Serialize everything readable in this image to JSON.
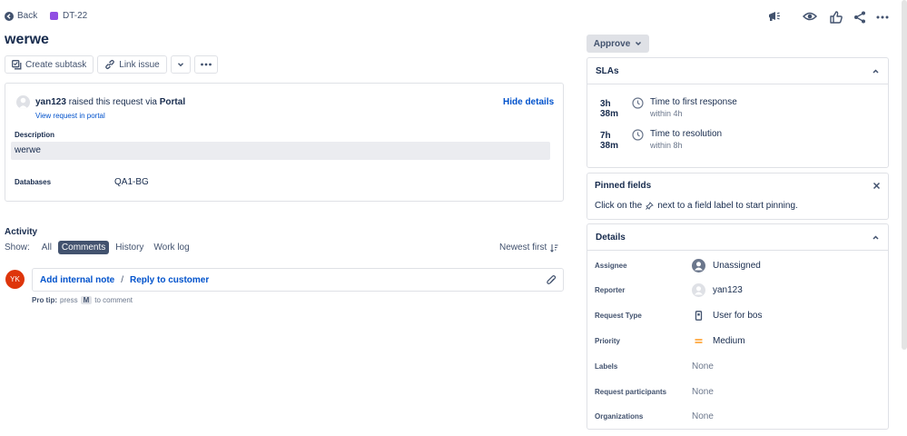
{
  "nav": {
    "back_label": "Back",
    "issue_key": "DT-22"
  },
  "issue": {
    "title": "werwe"
  },
  "toolbar": {
    "create_subtask": "Create subtask",
    "link_issue": "Link issue"
  },
  "request": {
    "user": "yan123",
    "raised_text": "raised this request via",
    "channel": "Portal",
    "view_link": "View request in portal",
    "hide_details": "Hide details",
    "description_label": "Description",
    "description_value": "werwe",
    "databases_label": "Databases",
    "databases_value": "QA1-BG"
  },
  "activity": {
    "heading": "Activity",
    "show_label": "Show:",
    "filters": [
      "All",
      "Comments",
      "History",
      "Work log"
    ],
    "active_filter": "Comments",
    "sort_label": "Newest first",
    "comment_avatar": "YK",
    "add_internal_note": "Add internal note",
    "separator": "/",
    "reply_to_customer": "Reply to customer",
    "pro_tip_label": "Pro tip:",
    "pro_tip_press": "press",
    "pro_tip_key": "M",
    "pro_tip_suffix": "to comment"
  },
  "approve": {
    "label": "Approve"
  },
  "slas": {
    "heading": "SLAs",
    "items": [
      {
        "time": "3h 38m",
        "name": "Time to first response",
        "target": "within 4h"
      },
      {
        "time": "7h 38m",
        "name": "Time to resolution",
        "target": "within 8h"
      }
    ]
  },
  "pinned": {
    "heading": "Pinned fields",
    "hint_before": "Click on the",
    "hint_after": "next to a field label to start pinning."
  },
  "details": {
    "heading": "Details",
    "assignee_label": "Assignee",
    "assignee_value": "Unassigned",
    "reporter_label": "Reporter",
    "reporter_value": "yan123",
    "request_type_label": "Request Type",
    "request_type_value": "User for bos",
    "priority_label": "Priority",
    "priority_value": "Medium",
    "labels_label": "Labels",
    "labels_value": "None",
    "participants_label": "Request participants",
    "participants_value": "None",
    "organizations_label": "Organizations",
    "organizations_value": "None"
  },
  "colors": {
    "link": "#0052cc",
    "issue_type": "#904ee2",
    "priority": "#ff991f",
    "avatar_yk": "#de350b"
  }
}
